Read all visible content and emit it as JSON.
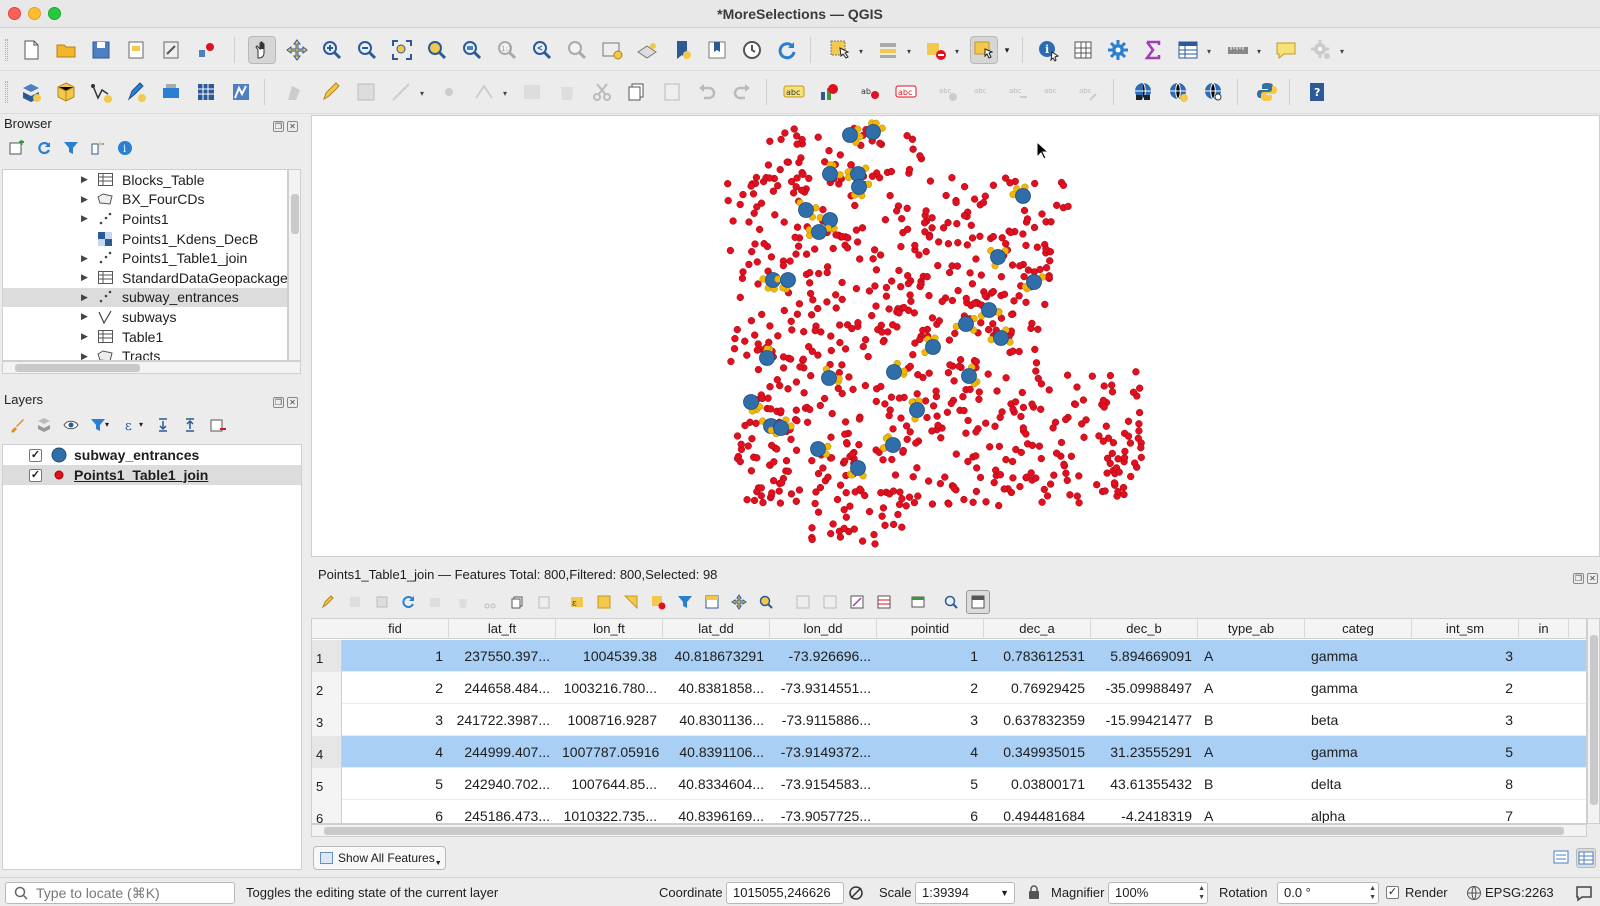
{
  "window": {
    "title": "*MoreSelections — QGIS"
  },
  "browser": {
    "title": "Browser",
    "items": [
      {
        "label": "Blocks_Table",
        "icon": "table-icon",
        "expandable": true
      },
      {
        "label": "BX_FourCDs",
        "icon": "polygon-layer-icon",
        "expandable": true
      },
      {
        "label": "Points1",
        "icon": "point-layer-icon",
        "expandable": true
      },
      {
        "label": "Points1_Kdens_DecB",
        "icon": "raster-layer-icon",
        "expandable": false
      },
      {
        "label": "Points1_Table1_join",
        "icon": "point-layer-icon",
        "expandable": true
      },
      {
        "label": "StandardDataGeopackage",
        "icon": "table-icon",
        "expandable": true
      },
      {
        "label": "subway_entrances",
        "icon": "point-layer-icon",
        "expandable": true,
        "selected": true
      },
      {
        "label": "subways",
        "icon": "line-layer-icon",
        "expandable": true
      },
      {
        "label": "Table1",
        "icon": "table-icon",
        "expandable": true
      },
      {
        "label": "Tracts",
        "icon": "polygon-layer-icon",
        "expandable": true
      }
    ]
  },
  "layers": {
    "title": "Layers",
    "items": [
      {
        "label": "subway_entrances",
        "checked": true,
        "color": "#2f6ea8",
        "selected": false
      },
      {
        "label": "Points1_Table1_join",
        "checked": true,
        "color": "#e0101e",
        "selected": true
      }
    ]
  },
  "map": {
    "red_color": "#e0101e",
    "blue_color": "#2f6ea8",
    "selection_color": "#f2b705"
  },
  "attribute_table": {
    "title": "Points1_Table1_join — Features Total: 800,Filtered: 800,Selected: 98",
    "columns": [
      "fid",
      "lat_ft",
      "lon_ft",
      "lat_dd",
      "lon_dd",
      "pointid",
      "dec_a",
      "dec_b",
      "type_ab",
      "categ",
      "int_sm",
      "in"
    ],
    "rows": [
      {
        "n": "1",
        "selected": true,
        "cells": [
          "1",
          "237550.397...",
          "1004539.38",
          "40.818673291",
          "-73.926696...",
          "1",
          "0.783612531",
          "5.894669091",
          "A",
          "gamma",
          "3",
          ""
        ]
      },
      {
        "n": "2",
        "selected": false,
        "cells": [
          "2",
          "244658.484...",
          "1003216.780...",
          "40.8381858...",
          "-73.9314551...",
          "2",
          "0.76929425",
          "-35.09988497",
          "A",
          "gamma",
          "2",
          ""
        ]
      },
      {
        "n": "3",
        "selected": false,
        "cells": [
          "3",
          "241722.3987...",
          "1008716.9287",
          "40.8301136...",
          "-73.9115886...",
          "3",
          "0.637832359",
          "-15.99421477",
          "B",
          "beta",
          "3",
          ""
        ]
      },
      {
        "n": "4",
        "selected": true,
        "cells": [
          "4",
          "244999.407...",
          "1007787.05916",
          "40.8391106...",
          "-73.9149372...",
          "4",
          "0.349935015",
          "31.23555291",
          "A",
          "gamma",
          "5",
          ""
        ]
      },
      {
        "n": "5",
        "selected": false,
        "cells": [
          "5",
          "242940.702...",
          "1007644.85...",
          "40.8334604...",
          "-73.9154583...",
          "5",
          "0.03800171",
          "43.61355432",
          "B",
          "delta",
          "8",
          ""
        ]
      },
      {
        "n": "6",
        "selected": false,
        "cells": [
          "6",
          "245186.473...",
          "1010322.735...",
          "40.8396169...",
          "-73.9057725...",
          "6",
          "0.494481684",
          "-4.2418319",
          "A",
          "alpha",
          "7",
          ""
        ]
      }
    ],
    "show_all_label": "Show All Features"
  },
  "status": {
    "locator_placeholder": "Type to locate (⌘K)",
    "message": "Toggles the editing state of the current layer",
    "coordinate_label": "Coordinate",
    "coordinate_value": "1015055,246626",
    "scale_label": "Scale",
    "scale_value": "1:39394",
    "magnifier_label": "Magnifier",
    "magnifier_value": "100%",
    "rotation_label": "Rotation",
    "rotation_value": "0.0 °",
    "render_label": "Render",
    "render_checked": true,
    "crs": "EPSG:2263"
  }
}
